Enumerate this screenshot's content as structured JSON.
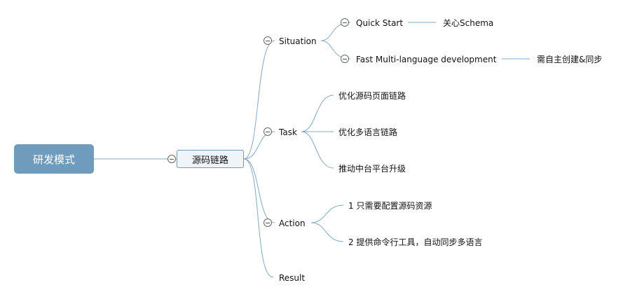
{
  "root": {
    "label": "研发模式"
  },
  "main": {
    "label": "源码链路"
  },
  "branches": {
    "situation": {
      "label": "Situation",
      "children": [
        {
          "label": "Quick Start",
          "note": "关心Schema"
        },
        {
          "label": "Fast Multi-language development",
          "note": "需自主创建&同步"
        }
      ]
    },
    "task": {
      "label": "Task",
      "children": [
        "优化源码页面链路",
        "优化多语言链路",
        "推动中台平台升级"
      ]
    },
    "action": {
      "label": "Action",
      "children": [
        "1 只需要配置源码资源",
        "2 提供命令行工具，自动同步多语言"
      ]
    },
    "result": {
      "label": "Result"
    }
  },
  "colors": {
    "line": "#7fa9c9",
    "root_fill": "#6f9bbd",
    "main_fill": "#eef4fa"
  }
}
